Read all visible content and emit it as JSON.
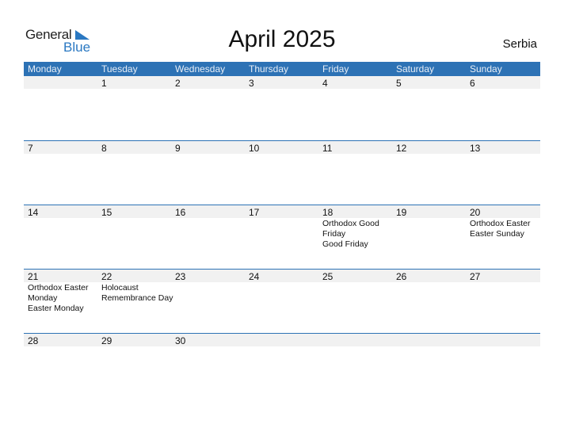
{
  "logo": {
    "general": "General",
    "blue": "Blue"
  },
  "title": "April 2025",
  "country": "Serbia",
  "colors": {
    "accent": "#2d72b5",
    "date_strip": "#f1f1f1"
  },
  "weekdays": [
    "Monday",
    "Tuesday",
    "Wednesday",
    "Thursday",
    "Friday",
    "Saturday",
    "Sunday"
  ],
  "weeks": [
    [
      {
        "day": ""
      },
      {
        "day": "1"
      },
      {
        "day": "2"
      },
      {
        "day": "3"
      },
      {
        "day": "4"
      },
      {
        "day": "5"
      },
      {
        "day": "6"
      }
    ],
    [
      {
        "day": "7"
      },
      {
        "day": "8"
      },
      {
        "day": "9"
      },
      {
        "day": "10"
      },
      {
        "day": "11"
      },
      {
        "day": "12"
      },
      {
        "day": "13"
      }
    ],
    [
      {
        "day": "14"
      },
      {
        "day": "15"
      },
      {
        "day": "16"
      },
      {
        "day": "17"
      },
      {
        "day": "18",
        "events": "Orthodox Good\nFriday\n  Good Friday"
      },
      {
        "day": "19"
      },
      {
        "day": "20",
        "events": "Orthodox Easter\n  Easter Sunday"
      }
    ],
    [
      {
        "day": "21",
        "events": "Orthodox Easter\nMonday\n  Easter Monday"
      },
      {
        "day": "22",
        "events": "Holocaust\nRemembrance Day"
      },
      {
        "day": "23"
      },
      {
        "day": "24"
      },
      {
        "day": "25"
      },
      {
        "day": "26"
      },
      {
        "day": "27"
      }
    ],
    [
      {
        "day": "28"
      },
      {
        "day": "29"
      },
      {
        "day": "30"
      },
      {
        "day": ""
      },
      {
        "day": ""
      },
      {
        "day": ""
      },
      {
        "day": ""
      }
    ]
  ]
}
